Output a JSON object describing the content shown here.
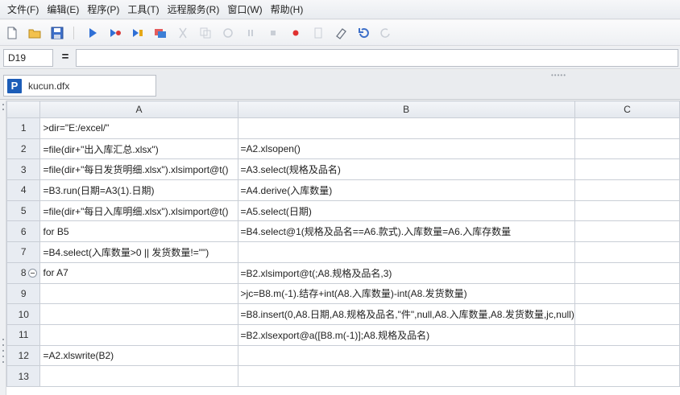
{
  "menu": [
    "文件(F)",
    "编辑(E)",
    "程序(P)",
    "工具(T)",
    "远程服务(R)",
    "窗口(W)",
    "帮助(H)"
  ],
  "toolbar_icons": [
    "new-file-icon",
    "open-folder-icon",
    "save-icon",
    "run-icon",
    "debug-icon",
    "step-icon",
    "calc-icon",
    "cut-icon",
    "copy-icon",
    "paste-icon",
    "pause-icon",
    "stop-icon",
    "breakpoint-icon",
    "clear-icon",
    "eraser-icon",
    "undo-icon",
    "redo-icon"
  ],
  "formula_bar": {
    "cell_ref": "D19",
    "equals": "=",
    "formula": ""
  },
  "file_tab": {
    "icon_letter": "P",
    "name": "kucun.dfx"
  },
  "columns": [
    "A",
    "B",
    "C"
  ],
  "rows": [
    {
      "num": "1",
      "a": ">dir=\"E:/excel/\"",
      "b": "",
      "c": ""
    },
    {
      "num": "2",
      "a": "=file(dir+\"出入库汇总.xlsx\")",
      "b": "=A2.xlsopen()",
      "c": ""
    },
    {
      "num": "3",
      "a": "=file(dir+\"每日发货明细.xlsx\").xlsimport@t()",
      "b": "=A3.select(规格及品名)",
      "c": ""
    },
    {
      "num": "4",
      "a": "=B3.run(日期=A3(1).日期)",
      "b": "=A4.derive(入库数量)",
      "c": ""
    },
    {
      "num": "5",
      "a": "=file(dir+\"每日入库明细.xlsx\").xlsimport@t()",
      "b": "=A5.select(日期)",
      "c": ""
    },
    {
      "num": "6",
      "a": "for B5",
      "b": "=B4.select@1(规格及品名==A6.款式).入库数量=A6.入库存数量",
      "c": ""
    },
    {
      "num": "7",
      "a": "=B4.select(入库数量>0 || 发货数量!=\"\")",
      "b": "",
      "c": ""
    },
    {
      "num": "8",
      "a": "for A7",
      "b": "=B2.xlsimport@t(;A8.规格及品名,3)",
      "c": ""
    },
    {
      "num": "9",
      "a": "",
      "b": ">jc=B8.m(-1).结存+int(A8.入库数量)-int(A8.发货数量)",
      "c": ""
    },
    {
      "num": "10",
      "a": "",
      "b": "=B8.insert(0,A8.日期,A8.规格及品名,\"件\",null,A8.入库数量,A8.发货数量,jc,null)",
      "c": ""
    },
    {
      "num": "11",
      "a": "",
      "b": "=B2.xlsexport@a([B8.m(-1)];A8.规格及品名)",
      "c": ""
    },
    {
      "num": "12",
      "a": "=A2.xlswrite(B2)",
      "b": "",
      "c": ""
    },
    {
      "num": "13",
      "a": "",
      "b": "",
      "c": ""
    }
  ],
  "collapsed_row": "8"
}
